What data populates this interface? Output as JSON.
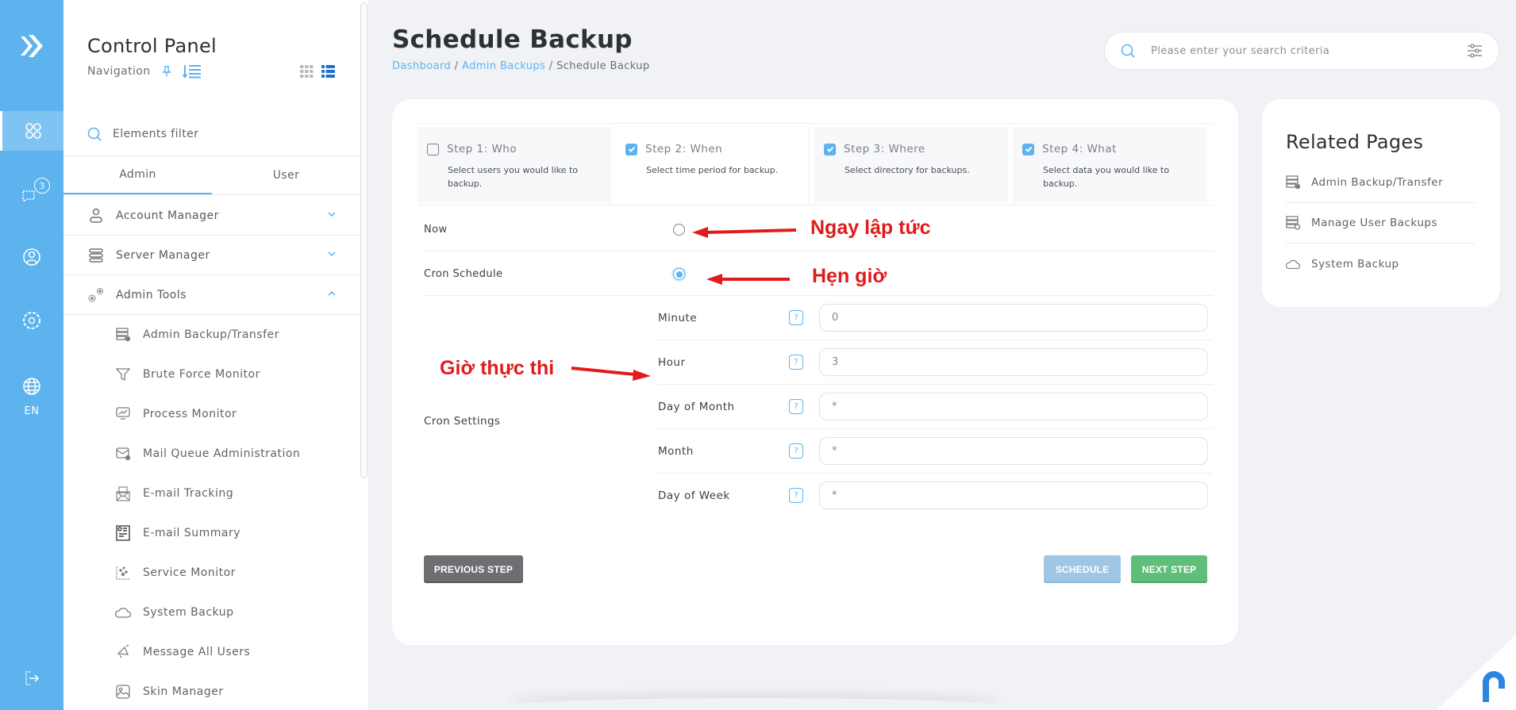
{
  "rail": {
    "items": [
      {
        "name": "apps",
        "icon": "apps-icon"
      },
      {
        "name": "messages",
        "icon": "chat-icon",
        "badge": "3"
      },
      {
        "name": "account",
        "icon": "user-circle-icon"
      },
      {
        "name": "settings",
        "icon": "gear-icon"
      },
      {
        "name": "language",
        "icon": "globe-icon",
        "label": "EN"
      },
      {
        "name": "logout",
        "icon": "logout-icon"
      }
    ],
    "accent": "#5cb3ee"
  },
  "nav": {
    "title": "Control Panel",
    "subtitle": "Navigation",
    "filter_placeholder": "Elements filter",
    "tabs": [
      {
        "label": "Admin",
        "active": true
      },
      {
        "label": "User",
        "active": false
      }
    ],
    "groups": [
      {
        "label": "Account Manager",
        "icon": "user-icon",
        "expanded": false
      },
      {
        "label": "Server Manager",
        "icon": "server-icon",
        "expanded": false
      },
      {
        "label": "Admin Tools",
        "icon": "gears-icon",
        "expanded": true
      }
    ],
    "items": [
      {
        "label": "Admin Backup/Transfer",
        "icon": "backup-server-icon"
      },
      {
        "label": "Brute Force Monitor",
        "icon": "funnel-icon"
      },
      {
        "label": "Process Monitor",
        "icon": "monitor-chart-icon"
      },
      {
        "label": "Mail Queue Administration",
        "icon": "mail-queue-icon"
      },
      {
        "label": "E-mail Tracking",
        "icon": "mail-tracking-icon"
      },
      {
        "label": "E-mail Summary",
        "icon": "mail-summary-icon"
      },
      {
        "label": "Service Monitor",
        "icon": "scatter-icon"
      },
      {
        "label": "System Backup",
        "icon": "cloud-icon"
      },
      {
        "label": "Message All Users",
        "icon": "megaphone-icon"
      },
      {
        "label": "Skin Manager",
        "icon": "image-icon"
      }
    ]
  },
  "header": {
    "title": "Schedule Backup",
    "breadcrumb": [
      {
        "label": "Dashboard",
        "link": true
      },
      {
        "label": "Admin Backups",
        "link": true
      },
      {
        "label": "Schedule Backup",
        "link": false
      }
    ],
    "breadcrumb_sep": " / ",
    "search_placeholder": "Please enter your search criteria"
  },
  "wizard": {
    "steps": [
      {
        "title": "Step 1: Who",
        "desc": "Select users you would like to backup.",
        "checked": false
      },
      {
        "title": "Step 2: When",
        "desc": "Select time period for backup.",
        "checked": true
      },
      {
        "title": "Step 3: Where",
        "desc": "Select directory for backups.",
        "checked": true
      },
      {
        "title": "Step 4: What",
        "desc": "Select data you would like to backup.",
        "checked": true
      }
    ],
    "when_options": [
      {
        "label": "Now",
        "selected": false
      },
      {
        "label": "Cron Schedule",
        "selected": true
      }
    ],
    "cron_settings_label": "Cron Settings",
    "help_glyph": "?",
    "cron_fields": [
      {
        "label": "Minute",
        "value": "0"
      },
      {
        "label": "Hour",
        "value": "3"
      },
      {
        "label": "Day of Month",
        "value": "*"
      },
      {
        "label": "Month",
        "value": "*"
      },
      {
        "label": "Day of Week",
        "value": "*"
      }
    ],
    "buttons": {
      "previous": "PREVIOUS STEP",
      "schedule": "SCHEDULE",
      "next": "NEXT STEP"
    }
  },
  "annotations": {
    "now": "Ngay lập tức",
    "cron": "Hẹn giờ",
    "hour": "Giờ thực thi",
    "color": "#e01b1b"
  },
  "related": {
    "title": "Related Pages",
    "items": [
      {
        "label": "Admin Backup/Transfer",
        "icon": "backup-server-icon"
      },
      {
        "label": "Manage User Backups",
        "icon": "user-backup-icon"
      },
      {
        "label": "System Backup",
        "icon": "cloud-icon"
      }
    ]
  }
}
